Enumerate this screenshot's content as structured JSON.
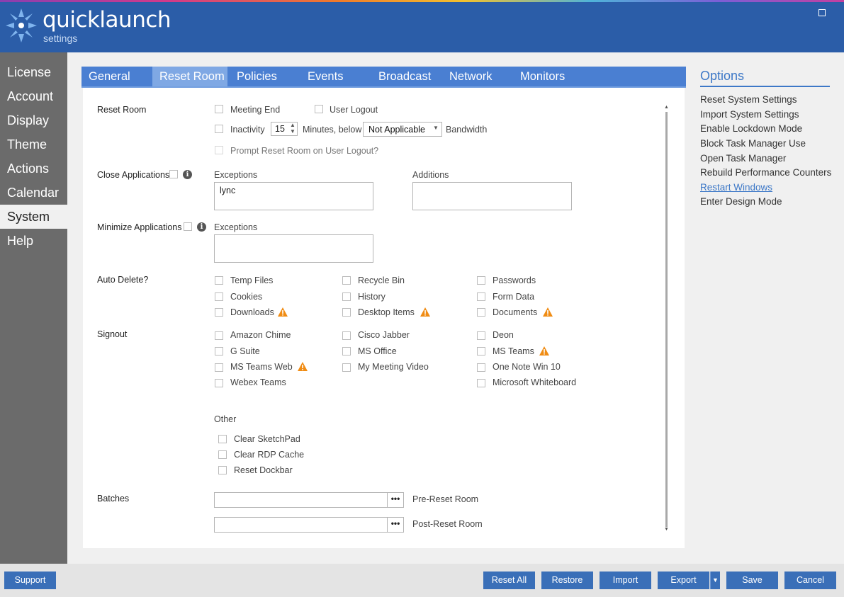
{
  "header": {
    "app_name": "quicklaunch",
    "subtitle": "settings"
  },
  "nav": {
    "items": [
      "License",
      "Account",
      "Display",
      "Theme",
      "Actions",
      "Calendar",
      "System",
      "Help"
    ],
    "active": "System"
  },
  "tabs": [
    "General",
    "Reset Room",
    "Policies",
    "Events",
    "Broadcast",
    "Network",
    "Monitors"
  ],
  "active_tab": "Reset Room",
  "reset_room": {
    "label": "Reset Room",
    "meeting_end": "Meeting End",
    "user_logout": "User Logout",
    "inactivity": "Inactivity",
    "inactivity_minutes": "15",
    "minutes_below": "Minutes, below",
    "bandwidth_value": "Not Applicable",
    "bandwidth_label": "Bandwidth",
    "prompt": "Prompt Reset Room on User Logout?"
  },
  "close_apps": {
    "label": "Close Applications",
    "exceptions_label": "Exceptions",
    "exceptions_value": "lync",
    "additions_label": "Additions",
    "additions_value": ""
  },
  "minimize_apps": {
    "label": "Minimize Applications",
    "exceptions_label": "Exceptions",
    "exceptions_value": ""
  },
  "auto_delete": {
    "label": "Auto Delete?",
    "items": [
      "Temp Files",
      "Recycle Bin",
      "Passwords",
      "Cookies",
      "History",
      "Form Data",
      "Downloads",
      "Desktop Items",
      "Documents"
    ]
  },
  "signout": {
    "label": "Signout",
    "items": [
      "Amazon Chime",
      "Cisco Jabber",
      "Deon",
      "G Suite",
      "MS Office",
      "MS Teams",
      "MS Teams Web",
      "My Meeting Video",
      "One Note Win 10",
      "Webex Teams",
      "Microsoft Whiteboard"
    ]
  },
  "other": {
    "label": "Other",
    "items": [
      "Clear SketchPad",
      "Clear RDP Cache",
      "Reset Dockbar"
    ]
  },
  "batches": {
    "label": "Batches",
    "pre_value": "",
    "pre_label": "Pre-Reset Room",
    "post_value": "",
    "post_label": "Post-Reset Room",
    "browse": "•••"
  },
  "options": {
    "title": "Options",
    "items": [
      "Reset System Settings",
      "Import System Settings",
      "Enable Lockdown Mode",
      "Block Task Manager Use",
      "Open Task Manager",
      "Rebuild Performance Counters",
      "Restart Windows",
      "Enter Design Mode"
    ]
  },
  "footer": {
    "support": "Support",
    "reset_all": "Reset All",
    "restore": "Restore",
    "import": "Import",
    "export": "Export",
    "save": "Save",
    "cancel": "Cancel"
  },
  "colors": {
    "header_bg": "#2b5da8",
    "tab_bg": "#4a7fd2",
    "accent": "#3d78c7",
    "warning": "#f08c14",
    "nav_bg": "#6b6b6b"
  }
}
